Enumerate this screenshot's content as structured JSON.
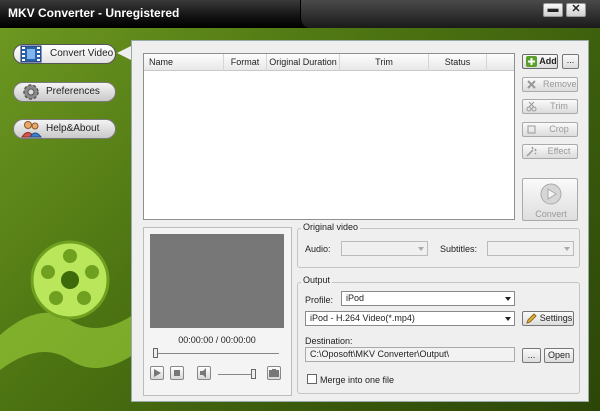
{
  "window": {
    "title": "MKV Converter - Unregistered",
    "min_label": "▬",
    "close_label": "✕"
  },
  "sidebar": {
    "items": [
      {
        "label": "Convert Video",
        "icon": "film-icon",
        "active": true
      },
      {
        "label": "Preferences",
        "icon": "gear-icon",
        "active": false
      },
      {
        "label": "Help&About",
        "icon": "people-icon",
        "active": false
      }
    ]
  },
  "file_list": {
    "columns": [
      "Name",
      "Format",
      "Original Duration",
      "Trim",
      "Status"
    ],
    "rows": []
  },
  "actions": {
    "add": "Add",
    "more": "...",
    "remove": "Remove",
    "trim": "Trim",
    "crop": "Crop",
    "effect": "Effect",
    "convert": "Convert"
  },
  "player": {
    "timecode": "00:00:00 / 00:00:00"
  },
  "original_video": {
    "legend": "Original video",
    "audio_label": "Audio:",
    "subtitles_label": "Subtitles:"
  },
  "output": {
    "legend": "Output",
    "profile_label": "Profile:",
    "profile_value": "iPod",
    "format_value": "iPod - H.264 Video(*.mp4)",
    "settings_label": "Settings",
    "destination_label": "Destination:",
    "destination_value": "C:\\Oposoft\\MKV Converter\\Output\\",
    "browse_label": "...",
    "open_label": "Open",
    "merge_label": "Merge into one file"
  },
  "colors": {
    "accent": "#5a8a1a",
    "title_bg": "#111111"
  }
}
